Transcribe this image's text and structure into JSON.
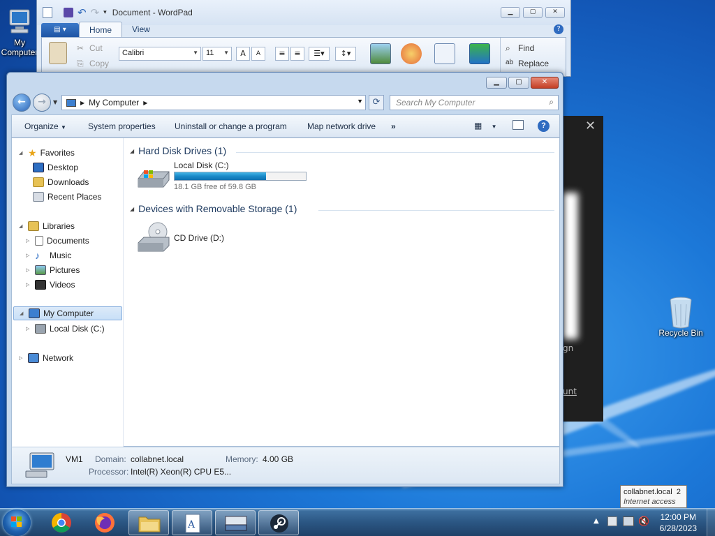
{
  "desktop": {
    "icons": {
      "my_computer": "My Computer",
      "recycle_bin": "Recycle Bin"
    }
  },
  "dark_panel": {
    "close": "✕",
    "partial_text_1": "gn",
    "partial_link": "unt"
  },
  "wordpad": {
    "title": "Document - WordPad",
    "tabs": [
      "Home",
      "View"
    ],
    "clipboard": {
      "cut": "Cut",
      "copy": "Copy"
    },
    "font_name": "Calibri",
    "font_size": "11",
    "find": "Find",
    "replace": "Replace"
  },
  "explorer": {
    "address": "My Computer",
    "search_placeholder": "Search My Computer",
    "commands": [
      "Organize",
      "System properties",
      "Uninstall or change a program",
      "Map network drive",
      "»"
    ],
    "nav": {
      "favorites": "Favorites",
      "desktop": "Desktop",
      "downloads": "Downloads",
      "recent_places": "Recent Places",
      "libraries": "Libraries",
      "documents": "Documents",
      "music": "Music",
      "pictures": "Pictures",
      "videos": "Videos",
      "my_computer": "My Computer",
      "local_disk": "Local Disk (C:)",
      "network": "Network"
    },
    "groups": {
      "hdd": "Hard Disk Drives (1)",
      "removable": "Devices with Removable Storage (1)"
    },
    "local_disk": {
      "label": "Local Disk (C:)",
      "free_text": "18.1 GB free of 59.8 GB",
      "used_fraction": 0.697
    },
    "cd_drive": {
      "label": "CD Drive (D:)"
    },
    "details": {
      "name": "VM1",
      "domain_key": "Domain:",
      "domain_val": "collabnet.local",
      "memory_key": "Memory:",
      "memory_val": "4.00 GB",
      "processor_key": "Processor:",
      "processor_val": "Intel(R) Xeon(R) CPU E5..."
    }
  },
  "taskbar": {
    "clock_time": "12:00 PM",
    "clock_date": "6/28/2023",
    "tooltip_title": "collabnet.local",
    "tooltip_num": "2",
    "tooltip_sub": "Internet access"
  },
  "colors": {
    "accent": "#1f55a5",
    "capacity_fill": "#1a8ac8",
    "selection": "#c8dff7"
  }
}
